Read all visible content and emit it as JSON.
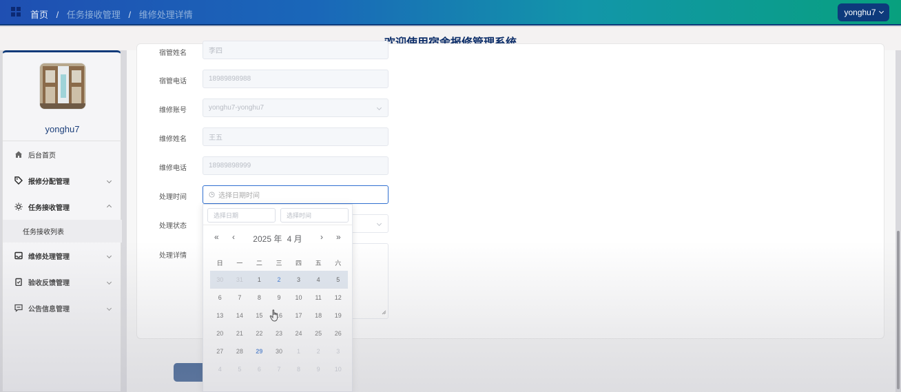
{
  "header": {
    "breadcrumb": [
      "首页",
      "任务接收管理",
      "维修处理详情"
    ],
    "separator": "/",
    "user_button": "yonghu7"
  },
  "title": "欢迎使用宿舍报修管理系统",
  "sidebar": {
    "username": "yonghu7",
    "items": [
      {
        "label": "后台首页",
        "icon": "home-icon"
      },
      {
        "label": "报修分配管理",
        "icon": "tag-icon"
      },
      {
        "label": "任务接收管理",
        "icon": "sun-icon"
      },
      {
        "label": "维修处理管理",
        "icon": "inbox-icon"
      },
      {
        "label": "验收反馈管理",
        "icon": "clipboard-icon"
      },
      {
        "label": "公告信息管理",
        "icon": "message-icon"
      }
    ],
    "subitem": "任务接收列表"
  },
  "form": {
    "labels": [
      "宿管姓名",
      "宿管电话",
      "维修账号",
      "维修姓名",
      "维修电话",
      "处理时间",
      "处理状态",
      "处理详情"
    ],
    "values": {
      "dorm_manager_name": "李四",
      "dorm_manager_phone": "18989898988",
      "repair_account": "yonghu7-yonghu7",
      "repair_name": "王五",
      "repair_phone": "18989898999"
    },
    "time_placeholder": "选择日期时间"
  },
  "datepicker": {
    "date_placeholder": "选择日期",
    "time_placeholder": "选择时间",
    "year": "2025 年",
    "month": "4 月",
    "nav": {
      "prev_year": "«",
      "prev_month": "‹",
      "next_month": "›",
      "next_year": "»"
    },
    "weekdays": [
      "日",
      "一",
      "二",
      "三",
      "四",
      "五",
      "六"
    ],
    "days": [
      {
        "d": "30",
        "o": true
      },
      {
        "d": "31",
        "o": true
      },
      {
        "d": "1"
      },
      {
        "d": "2",
        "sel": true
      },
      {
        "d": "3"
      },
      {
        "d": "4"
      },
      {
        "d": "5"
      },
      {
        "d": "6"
      },
      {
        "d": "7"
      },
      {
        "d": "8"
      },
      {
        "d": "9"
      },
      {
        "d": "10"
      },
      {
        "d": "11"
      },
      {
        "d": "12"
      },
      {
        "d": "13"
      },
      {
        "d": "14"
      },
      {
        "d": "15"
      },
      {
        "d": "16"
      },
      {
        "d": "17"
      },
      {
        "d": "18"
      },
      {
        "d": "19"
      },
      {
        "d": "20"
      },
      {
        "d": "21"
      },
      {
        "d": "22"
      },
      {
        "d": "23"
      },
      {
        "d": "24"
      },
      {
        "d": "25"
      },
      {
        "d": "26"
      },
      {
        "d": "27"
      },
      {
        "d": "28"
      },
      {
        "d": "29",
        "today": true
      },
      {
        "d": "30"
      },
      {
        "d": "1",
        "o": true
      },
      {
        "d": "2",
        "o": true
      },
      {
        "d": "3",
        "o": true
      },
      {
        "d": "4",
        "o": true
      },
      {
        "d": "5",
        "o": true
      },
      {
        "d": "6",
        "o": true
      },
      {
        "d": "7",
        "o": true
      },
      {
        "d": "8",
        "o": true
      },
      {
        "d": "9",
        "o": true
      },
      {
        "d": "10",
        "o": true
      }
    ]
  }
}
